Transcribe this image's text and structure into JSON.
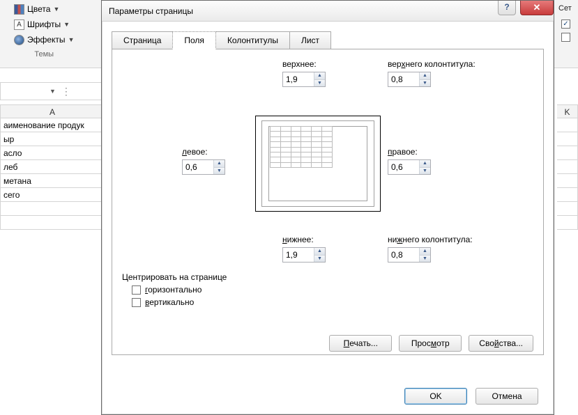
{
  "ribbon": {
    "colors": "Цвета",
    "fonts": "Шрифты",
    "effects": "Эффекты",
    "themes_label": "Темы"
  },
  "right": {
    "grid_label": "Сет",
    "check1": true,
    "check2": false
  },
  "sheet": {
    "col_left": "A",
    "col_right": "K",
    "rows": [
      "аименование продук",
      "ыр",
      "асло",
      "леб",
      "метана",
      "сего"
    ]
  },
  "dialog": {
    "title": "Параметры страницы",
    "tabs": [
      "Страница",
      "Поля",
      "Колонтитулы",
      "Лист"
    ],
    "active_tab": 1,
    "margins": {
      "top_label": "верхнее:",
      "top": "1,9",
      "header_label": "верхнего колонтитула:",
      "header": "0,8",
      "left_label": "левое:",
      "left": "0,6",
      "right_label": "правое:",
      "right": "0,6",
      "bottom_label": "нижнее:",
      "bottom": "1,9",
      "footer_label": "нижнего колонтитула:",
      "footer": "0,8"
    },
    "center": {
      "group": "Центрировать на странице",
      "horiz": "горизонтально",
      "vert": "вертикально"
    },
    "buttons": {
      "print": "Печать...",
      "preview": "Просмотр",
      "options": "Свойства...",
      "ok": "OK",
      "cancel": "Отмена"
    }
  }
}
